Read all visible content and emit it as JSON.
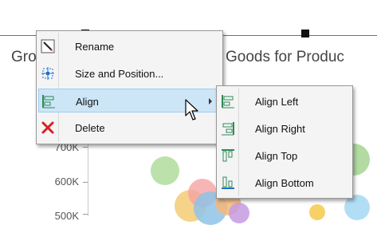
{
  "chart": {
    "title_left": "Gro",
    "title_right": "Goods for Produc",
    "y_ticks": [
      "700K",
      "600K",
      "500K"
    ]
  },
  "context_menu": {
    "items": [
      {
        "label": "Rename",
        "icon": "rename-icon"
      },
      {
        "label": "Size and Position...",
        "icon": "size-position-icon"
      },
      {
        "label": "Align",
        "icon": "align-icon",
        "has_submenu": true,
        "highlighted": true
      },
      {
        "label": "Delete",
        "icon": "delete-icon"
      }
    ]
  },
  "align_submenu": {
    "items": [
      {
        "label": "Align Left",
        "icon": "align-left-icon"
      },
      {
        "label": "Align Right",
        "icon": "align-right-icon"
      },
      {
        "label": "Align Top",
        "icon": "align-top-icon"
      },
      {
        "label": "Align Bottom",
        "icon": "align-bottom-icon"
      }
    ]
  },
  "colors": {
    "menu_highlight": "#cde6f7",
    "icon_green": "#2e8b57",
    "delete_red": "#d6201e"
  }
}
